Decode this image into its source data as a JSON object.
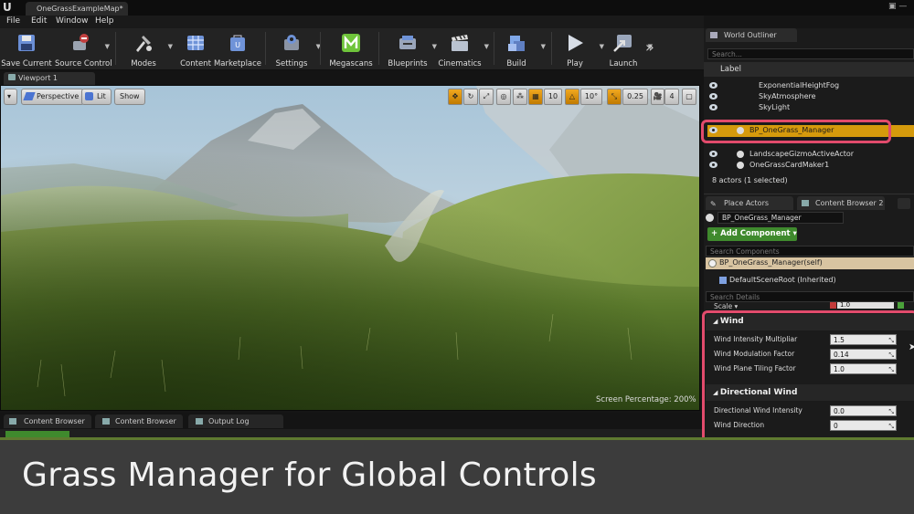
{
  "window": {
    "map_tab": "OneGrassExampleMap*"
  },
  "menu": {
    "items": [
      "File",
      "Edit",
      "Window",
      "Help"
    ]
  },
  "toolbar": {
    "items": [
      {
        "label": "Save Current",
        "icon": "floppy-disk-icon"
      },
      {
        "label": "Source Control",
        "icon": "source-control-icon"
      },
      {
        "label": "Modes",
        "icon": "modes-tools-icon"
      },
      {
        "label": "Content",
        "icon": "content-grid-icon"
      },
      {
        "label": "Marketplace",
        "icon": "marketplace-icon"
      },
      {
        "label": "Settings",
        "icon": "settings-icon"
      },
      {
        "label": "Megascans",
        "icon": "megascans-icon"
      },
      {
        "label": "Blueprints",
        "icon": "blueprints-icon"
      },
      {
        "label": "Cinematics",
        "icon": "clapperboard-icon"
      },
      {
        "label": "Build",
        "icon": "build-icon"
      },
      {
        "label": "Play",
        "icon": "play-icon"
      },
      {
        "label": "Launch",
        "icon": "launch-icon"
      }
    ]
  },
  "viewport": {
    "tab_label": "Viewport 1",
    "perspective_label": "Perspective",
    "lit_label": "Lit",
    "show_label": "Show",
    "grid_snap": "10",
    "rotation_snap": "10°",
    "scale_snap": "0.25",
    "camera_speed": "4",
    "screen_percentage": "Screen Percentage: 200%"
  },
  "bottom_tabs": [
    "Content Browser 1",
    "Content Browser 3",
    "Output Log"
  ],
  "outliner": {
    "tab_label": "World Outliner",
    "search_placeholder": "Search...",
    "column_label": "Label",
    "rows": [
      "ExponentialHeightFog",
      "SkyAtmosphere",
      "SkyLight",
      "BP_OneGrass_Manager",
      "LandscapeGizmoActiveActor",
      "OneGrassCardMaker1"
    ],
    "selected_row": "BP_OneGrass_Manager",
    "status": "8 actors (1 selected)"
  },
  "details": {
    "tabs": [
      "Place Actors",
      "Content Browser 2"
    ],
    "actor_name": "BP_OneGrass_Manager",
    "add_component_label": "+ Add Component ▾",
    "search_components_placeholder": "Search Components",
    "self_component": "BP_OneGrass_Manager(self)",
    "default_root": "DefaultSceneRoot (Inherited)",
    "search_details_placeholder": "Search Details",
    "scale_label": "Scale ▾",
    "scale_value": "1.0",
    "categories": [
      {
        "name": "Wind",
        "properties": [
          {
            "label": "Wind Intensity Multipliar",
            "value": "1.5"
          },
          {
            "label": "Wind Modulation Factor",
            "value": "0.14"
          },
          {
            "label": "Wind Plane Tiling Factor",
            "value": "1.0"
          }
        ]
      },
      {
        "name": "Directional Wind",
        "properties": [
          {
            "label": "Directional Wind Intensity",
            "value": "0.0"
          },
          {
            "label": "Wind Direction",
            "value": "0"
          }
        ]
      }
    ]
  },
  "caption": "Grass Manager for Global Controls",
  "colors": {
    "selection": "#d59a0c",
    "highlight": "#e24b6c",
    "caption_bar": "#3c3c3c",
    "accent_green": "#5f7a30"
  }
}
